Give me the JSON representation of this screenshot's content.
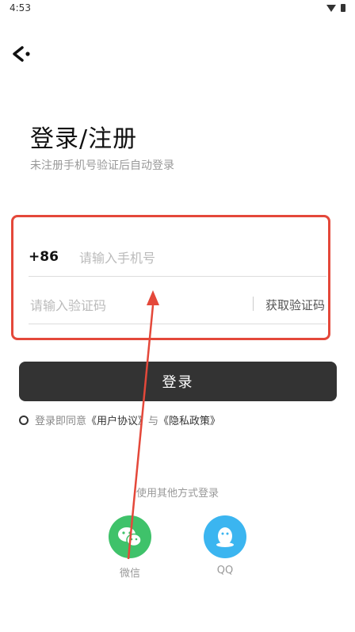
{
  "status": {
    "time": "4:53"
  },
  "header": {
    "title": "登录/注册",
    "subtitle": "未注册手机号验证后自动登录"
  },
  "phone": {
    "country_code": "+86",
    "placeholder": "请输入手机号"
  },
  "verify": {
    "placeholder": "请输入验证码",
    "get_code_label": "获取验证码"
  },
  "login_button": "登录",
  "agreement": {
    "prefix": "登录即同意",
    "user_agreement": "《用户协议》",
    "and": "与",
    "privacy": "《隐私政策》"
  },
  "other_login": {
    "title": "使用其他方式登录",
    "wechat": "微信",
    "qq": "QQ"
  },
  "colors": {
    "accent": "#333333",
    "highlight": "#e4483a",
    "wechat": "#3fc26a",
    "qq": "#3bb5f0"
  }
}
